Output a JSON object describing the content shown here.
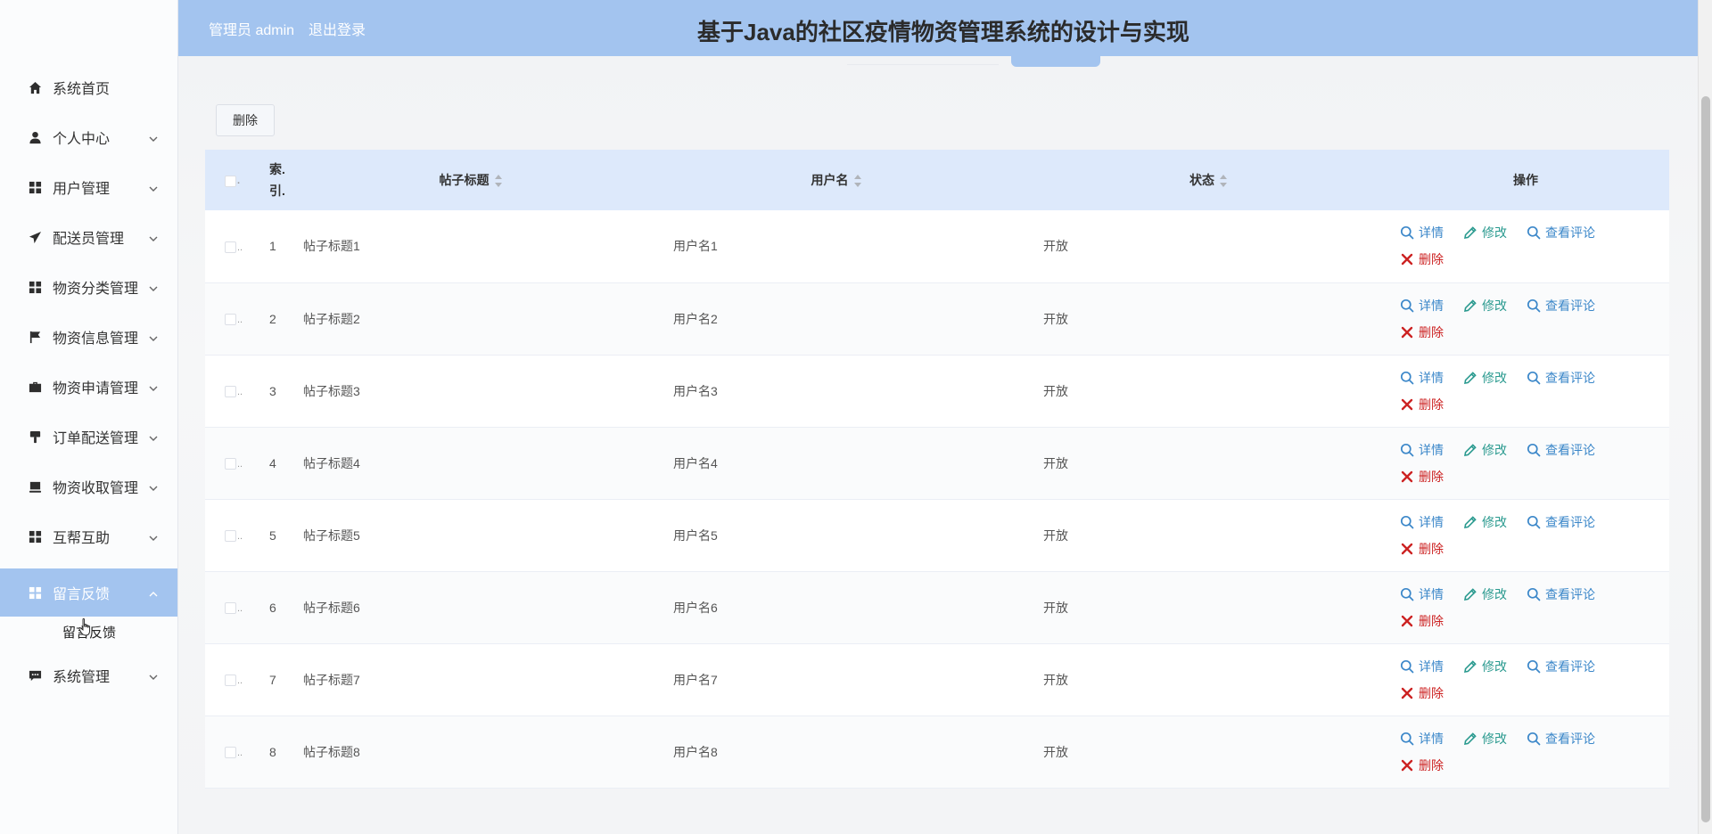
{
  "header": {
    "admin_label": "管理员 admin",
    "logout_label": "退出登录",
    "title": "基于Java的社区疫情物资管理系统的设计与实现"
  },
  "sidebar": {
    "items": [
      {
        "label": "系统首页",
        "icon": "home-icon"
      },
      {
        "label": "个人中心",
        "icon": "user-icon"
      },
      {
        "label": "用户管理",
        "icon": "grid-icon"
      },
      {
        "label": "配送员管理",
        "icon": "send-icon"
      },
      {
        "label": "物资分类管理",
        "icon": "grid-icon"
      },
      {
        "label": "物资信息管理",
        "icon": "flag-icon"
      },
      {
        "label": "物资申请管理",
        "icon": "briefcase-icon"
      },
      {
        "label": "订单配送管理",
        "icon": "brush-icon"
      },
      {
        "label": "物资收取管理",
        "icon": "inbox-icon"
      },
      {
        "label": "互帮互助",
        "icon": "grid-icon"
      },
      {
        "label": "留言反馈",
        "icon": "grid-icon"
      },
      {
        "label": "系统管理",
        "icon": "chat-icon"
      }
    ],
    "submenu_label": "留言反馈"
  },
  "toolbar": {
    "delete_label": "删除"
  },
  "table": {
    "headers": {
      "index": "索引",
      "index_line1": "索.",
      "index_line2": "引.",
      "title": "帖子标题",
      "username": "用户名",
      "status": "状态",
      "actions": "操作"
    },
    "rows": [
      {
        "index": "1",
        "title": "帖子标题1",
        "username": "用户名1",
        "status": "开放"
      },
      {
        "index": "2",
        "title": "帖子标题2",
        "username": "用户名2",
        "status": "开放"
      },
      {
        "index": "3",
        "title": "帖子标题3",
        "username": "用户名3",
        "status": "开放"
      },
      {
        "index": "4",
        "title": "帖子标题4",
        "username": "用户名4",
        "status": "开放"
      },
      {
        "index": "5",
        "title": "帖子标题5",
        "username": "用户名5",
        "status": "开放"
      },
      {
        "index": "6",
        "title": "帖子标题6",
        "username": "用户名6",
        "status": "开放"
      },
      {
        "index": "7",
        "title": "帖子标题7",
        "username": "用户名7",
        "status": "开放"
      },
      {
        "index": "8",
        "title": "帖子标题8",
        "username": "用户名8",
        "status": "开放"
      }
    ],
    "actions": {
      "detail": "详情",
      "edit": "修改",
      "comments": "查看评论",
      "delete": "删除"
    }
  },
  "colors": {
    "header_bg": "#a3c4ef",
    "active_menu_bg": "#a3c4ef",
    "table_header_bg": "#dde9fb",
    "action_blue": "#3b87c9",
    "action_teal": "#2a9a8f",
    "action_red": "#cc2222"
  }
}
